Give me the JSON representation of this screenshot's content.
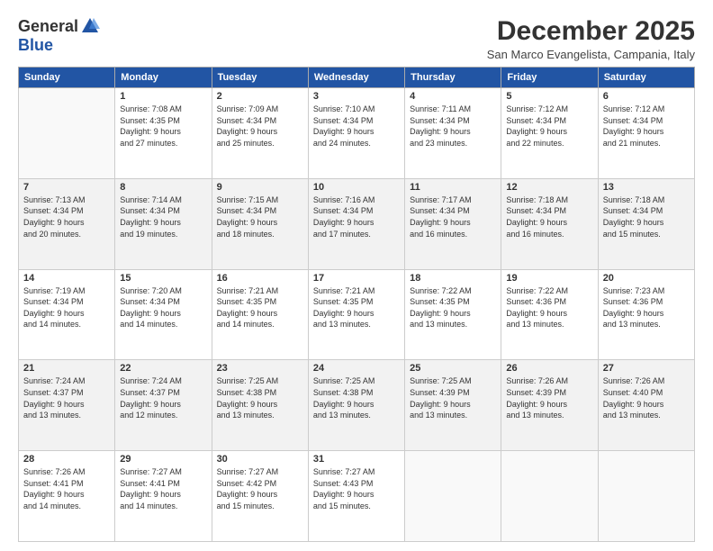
{
  "logo": {
    "general": "General",
    "blue": "Blue"
  },
  "title": "December 2025",
  "location": "San Marco Evangelista, Campania, Italy",
  "days_of_week": [
    "Sunday",
    "Monday",
    "Tuesday",
    "Wednesday",
    "Thursday",
    "Friday",
    "Saturday"
  ],
  "weeks": [
    [
      {
        "day": "",
        "info": ""
      },
      {
        "day": "1",
        "info": "Sunrise: 7:08 AM\nSunset: 4:35 PM\nDaylight: 9 hours\nand 27 minutes."
      },
      {
        "day": "2",
        "info": "Sunrise: 7:09 AM\nSunset: 4:34 PM\nDaylight: 9 hours\nand 25 minutes."
      },
      {
        "day": "3",
        "info": "Sunrise: 7:10 AM\nSunset: 4:34 PM\nDaylight: 9 hours\nand 24 minutes."
      },
      {
        "day": "4",
        "info": "Sunrise: 7:11 AM\nSunset: 4:34 PM\nDaylight: 9 hours\nand 23 minutes."
      },
      {
        "day": "5",
        "info": "Sunrise: 7:12 AM\nSunset: 4:34 PM\nDaylight: 9 hours\nand 22 minutes."
      },
      {
        "day": "6",
        "info": "Sunrise: 7:12 AM\nSunset: 4:34 PM\nDaylight: 9 hours\nand 21 minutes."
      }
    ],
    [
      {
        "day": "7",
        "info": "Sunrise: 7:13 AM\nSunset: 4:34 PM\nDaylight: 9 hours\nand 20 minutes."
      },
      {
        "day": "8",
        "info": "Sunrise: 7:14 AM\nSunset: 4:34 PM\nDaylight: 9 hours\nand 19 minutes."
      },
      {
        "day": "9",
        "info": "Sunrise: 7:15 AM\nSunset: 4:34 PM\nDaylight: 9 hours\nand 18 minutes."
      },
      {
        "day": "10",
        "info": "Sunrise: 7:16 AM\nSunset: 4:34 PM\nDaylight: 9 hours\nand 17 minutes."
      },
      {
        "day": "11",
        "info": "Sunrise: 7:17 AM\nSunset: 4:34 PM\nDaylight: 9 hours\nand 16 minutes."
      },
      {
        "day": "12",
        "info": "Sunrise: 7:18 AM\nSunset: 4:34 PM\nDaylight: 9 hours\nand 16 minutes."
      },
      {
        "day": "13",
        "info": "Sunrise: 7:18 AM\nSunset: 4:34 PM\nDaylight: 9 hours\nand 15 minutes."
      }
    ],
    [
      {
        "day": "14",
        "info": "Sunrise: 7:19 AM\nSunset: 4:34 PM\nDaylight: 9 hours\nand 14 minutes."
      },
      {
        "day": "15",
        "info": "Sunrise: 7:20 AM\nSunset: 4:34 PM\nDaylight: 9 hours\nand 14 minutes."
      },
      {
        "day": "16",
        "info": "Sunrise: 7:21 AM\nSunset: 4:35 PM\nDaylight: 9 hours\nand 14 minutes."
      },
      {
        "day": "17",
        "info": "Sunrise: 7:21 AM\nSunset: 4:35 PM\nDaylight: 9 hours\nand 13 minutes."
      },
      {
        "day": "18",
        "info": "Sunrise: 7:22 AM\nSunset: 4:35 PM\nDaylight: 9 hours\nand 13 minutes."
      },
      {
        "day": "19",
        "info": "Sunrise: 7:22 AM\nSunset: 4:36 PM\nDaylight: 9 hours\nand 13 minutes."
      },
      {
        "day": "20",
        "info": "Sunrise: 7:23 AM\nSunset: 4:36 PM\nDaylight: 9 hours\nand 13 minutes."
      }
    ],
    [
      {
        "day": "21",
        "info": "Sunrise: 7:24 AM\nSunset: 4:37 PM\nDaylight: 9 hours\nand 13 minutes."
      },
      {
        "day": "22",
        "info": "Sunrise: 7:24 AM\nSunset: 4:37 PM\nDaylight: 9 hours\nand 12 minutes."
      },
      {
        "day": "23",
        "info": "Sunrise: 7:25 AM\nSunset: 4:38 PM\nDaylight: 9 hours\nand 13 minutes."
      },
      {
        "day": "24",
        "info": "Sunrise: 7:25 AM\nSunset: 4:38 PM\nDaylight: 9 hours\nand 13 minutes."
      },
      {
        "day": "25",
        "info": "Sunrise: 7:25 AM\nSunset: 4:39 PM\nDaylight: 9 hours\nand 13 minutes."
      },
      {
        "day": "26",
        "info": "Sunrise: 7:26 AM\nSunset: 4:39 PM\nDaylight: 9 hours\nand 13 minutes."
      },
      {
        "day": "27",
        "info": "Sunrise: 7:26 AM\nSunset: 4:40 PM\nDaylight: 9 hours\nand 13 minutes."
      }
    ],
    [
      {
        "day": "28",
        "info": "Sunrise: 7:26 AM\nSunset: 4:41 PM\nDaylight: 9 hours\nand 14 minutes."
      },
      {
        "day": "29",
        "info": "Sunrise: 7:27 AM\nSunset: 4:41 PM\nDaylight: 9 hours\nand 14 minutes."
      },
      {
        "day": "30",
        "info": "Sunrise: 7:27 AM\nSunset: 4:42 PM\nDaylight: 9 hours\nand 15 minutes."
      },
      {
        "day": "31",
        "info": "Sunrise: 7:27 AM\nSunset: 4:43 PM\nDaylight: 9 hours\nand 15 minutes."
      },
      {
        "day": "",
        "info": ""
      },
      {
        "day": "",
        "info": ""
      },
      {
        "day": "",
        "info": ""
      }
    ]
  ],
  "shaded_weeks": [
    1,
    3
  ]
}
